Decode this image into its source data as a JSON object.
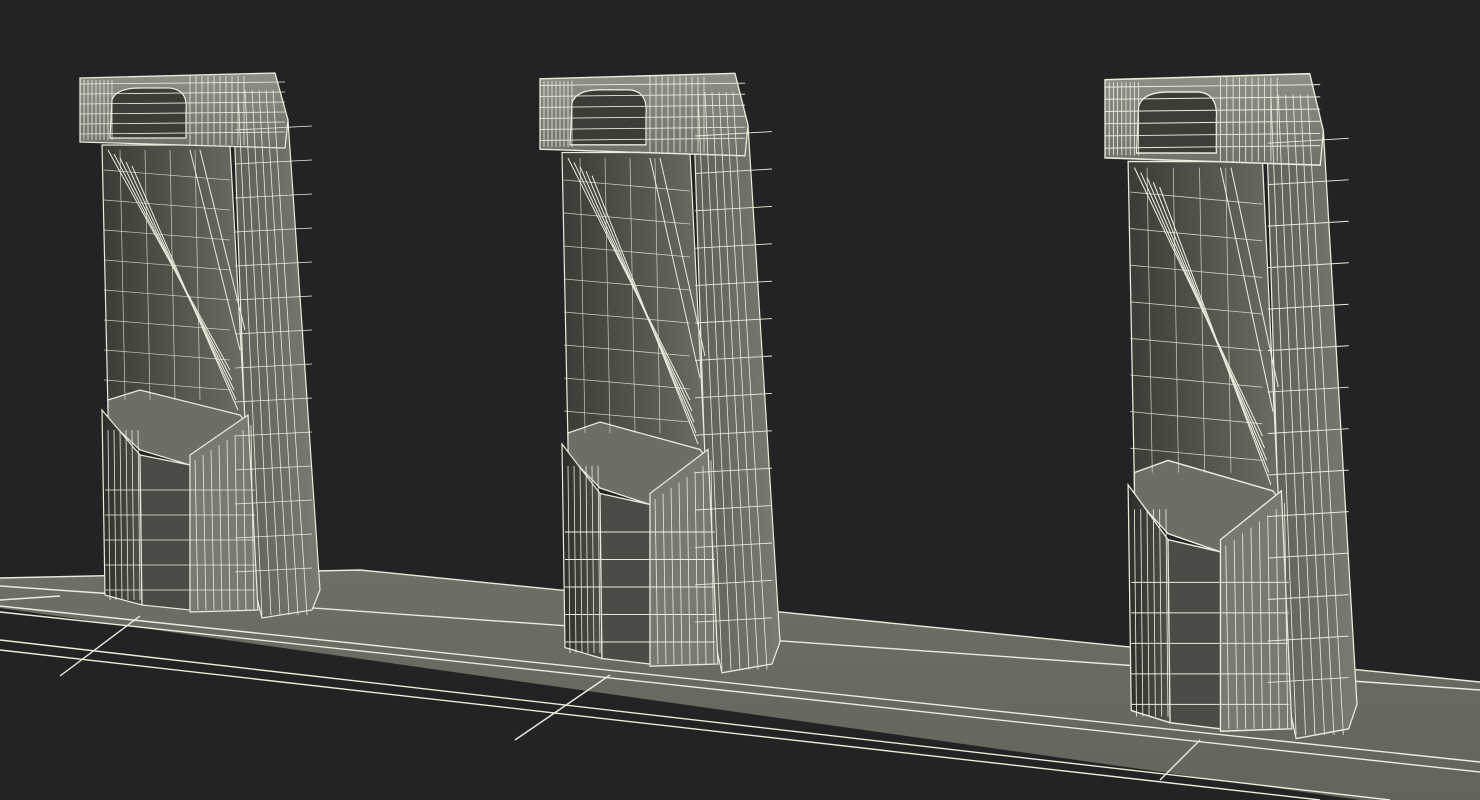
{
  "scene": {
    "background_color": "#222423",
    "surface_color": "#6a6b62",
    "surface_dark_color": "#3a3c36",
    "wire_color": "#eceadb",
    "objects": [
      "holder-left",
      "holder-middle",
      "holder-right"
    ],
    "render_style": "wireframe-over-shaded"
  }
}
